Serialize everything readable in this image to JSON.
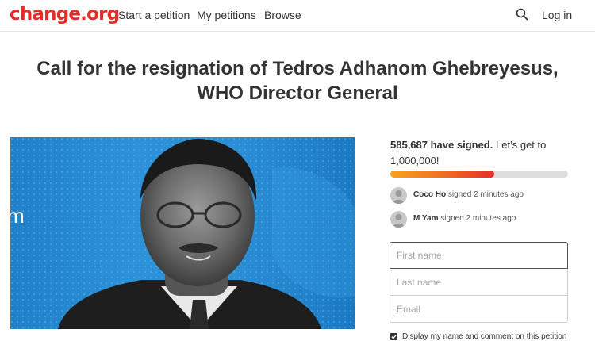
{
  "header": {
    "logo": "change.org",
    "nav": [
      "Start a petition",
      "My petitions",
      "Browse"
    ],
    "login": "Log in"
  },
  "petition": {
    "title": "Call for the resignation of Tedros Adhanom Ghebreyesus, WHO Director General",
    "hero_text": "m"
  },
  "progress": {
    "signed_count": "585,687 have signed.",
    "goal_text": "Let’s get to 1,000,000!",
    "fraction": 0.586
  },
  "signers": [
    {
      "name": "Coco Ho",
      "action": "signed 2 minutes ago"
    },
    {
      "name": "M Yam",
      "action": "signed 2 minutes ago"
    }
  ],
  "form": {
    "first_name_placeholder": "First name",
    "last_name_placeholder": "Last name",
    "email_placeholder": "Email",
    "display_checkbox_label": "Display my name and comment on this petition",
    "display_checked": true
  },
  "colors": {
    "brand": "#e52d27",
    "hero_background": "#2a8cd4",
    "progress_start": "#f7a21b",
    "progress_end": "#e52d27"
  },
  "icons": {
    "search": "search-icon",
    "avatar": "user-avatar-icon",
    "check": "check-icon"
  }
}
